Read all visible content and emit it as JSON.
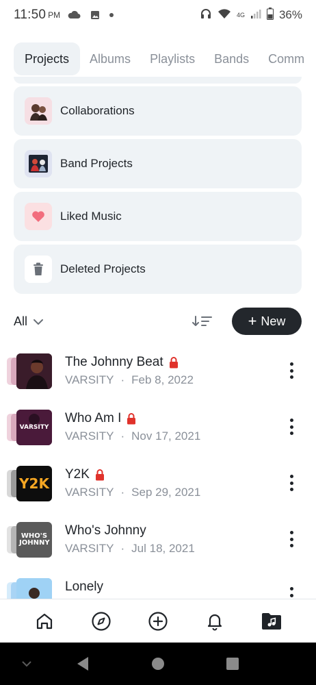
{
  "status_bar": {
    "time": "11:50",
    "ampm": "PM",
    "battery": "36%",
    "network": "4G"
  },
  "tabs": [
    {
      "label": "Projects",
      "active": true
    },
    {
      "label": "Albums",
      "active": false
    },
    {
      "label": "Playlists",
      "active": false
    },
    {
      "label": "Bands",
      "active": false
    },
    {
      "label": "Comm",
      "active": false
    }
  ],
  "library": [
    {
      "label": "Collaborations",
      "icon": "collaborations-image-icon"
    },
    {
      "label": "Band Projects",
      "icon": "band-projects-image-icon"
    },
    {
      "label": "Liked Music",
      "icon": "heart-icon"
    },
    {
      "label": "Deleted Projects",
      "icon": "trash-icon"
    }
  ],
  "filter": {
    "label": "All",
    "sort_icon": "sort-descending-icon",
    "new_label": "New"
  },
  "projects": [
    {
      "title": "The Johnny Beat",
      "artist": "VARSITY",
      "date": "Feb 8, 2022",
      "locked": true
    },
    {
      "title": "Who Am I",
      "artist": "VARSITY",
      "date": "Nov 17, 2021",
      "locked": true,
      "cover_text": "VARSITY"
    },
    {
      "title": "Y2K",
      "artist": "VARSITY",
      "date": "Sep 29, 2021",
      "locked": true,
      "cover_text": "Y2K"
    },
    {
      "title": "Who's Johnny",
      "artist": "VARSITY",
      "date": "Jul 18, 2021",
      "locked": false,
      "cover_text": "WHO'S JOHNNY"
    },
    {
      "title": "Lonely",
      "artist": "",
      "date": "",
      "locked": false
    }
  ],
  "bottom_nav": [
    "home-icon",
    "compass-icon",
    "add-circle-icon",
    "bell-icon",
    "music-library-icon"
  ],
  "colors": {
    "accent_dark": "#23272c",
    "card_bg": "#eff3f6",
    "lock_red": "#e0322b",
    "heart_pink": "#f26d7d",
    "muted_text": "#8a9099"
  }
}
